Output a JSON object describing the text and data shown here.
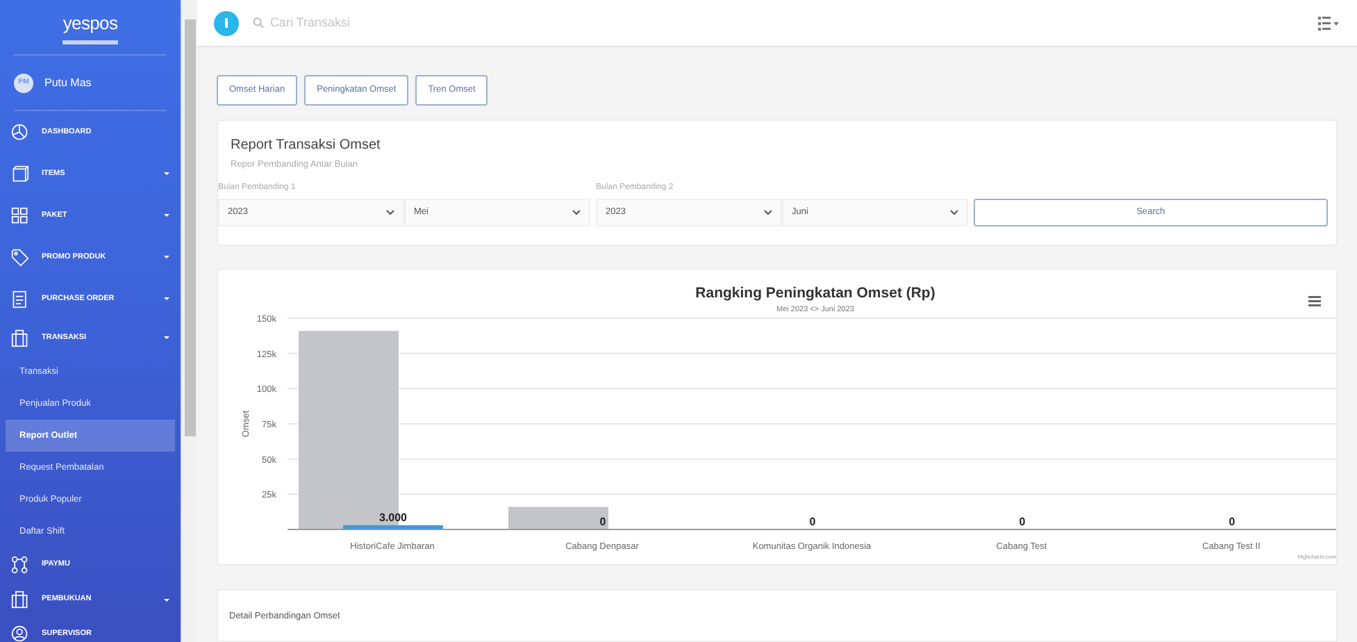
{
  "sidebar": {
    "logo": "yespos",
    "user": {
      "initials": "PM",
      "name": "Putu Mas"
    },
    "items": [
      {
        "label": "DASHBOARD",
        "has_caret": false
      },
      {
        "label": "ITEMS",
        "has_caret": true
      },
      {
        "label": "PAKET",
        "has_caret": true
      },
      {
        "label": "PROMO PRODUK",
        "has_caret": true
      },
      {
        "label": "PURCHASE ORDER",
        "has_caret": true
      },
      {
        "label": "TRANSAKSI",
        "has_caret": true,
        "children": [
          {
            "label": "Transaksi",
            "selected": false
          },
          {
            "label": "Penjualan Produk",
            "selected": false
          },
          {
            "label": "Report Outlet",
            "selected": true
          },
          {
            "label": "Request Pembatalan",
            "selected": false
          },
          {
            "label": "Produk Populer",
            "selected": false
          },
          {
            "label": "Daftar Shift",
            "selected": false
          }
        ]
      },
      {
        "label": "IPAYMU",
        "has_caret": false
      },
      {
        "label": "PEMBUKUAN",
        "has_caret": true
      },
      {
        "label": "SUPERVISOR",
        "has_caret": false
      }
    ]
  },
  "topbar": {
    "search": {
      "placeholder": "Cari Transaksi"
    }
  },
  "report_tabs": [
    "Omset Harian",
    "Peningkatan Omset",
    "Tren Omset"
  ],
  "form": {
    "title": "Report Transaksi Omset",
    "subtitle": "Repor Pembanding Antar Bulan",
    "groups": [
      {
        "label": "Bulan Pembanding 1",
        "year": "2023",
        "month": "Mei"
      },
      {
        "label": "Bulan Pembanding 2",
        "year": "2023",
        "month": "Juni"
      }
    ],
    "search_button": "Search"
  },
  "chart": {
    "credit": "Highcharts.com",
    "chart_data": {
      "type": "bar",
      "orientation": "vertical",
      "title": "Rangking Peningkatan Omset (Rp)",
      "subtitle": "Mei 2023 <> Juni 2023",
      "ylabel": "Omset",
      "categories": [
        "HistoriCafe Jimbaran",
        "Cabang Denpasar",
        "Komunitas Organik Indonesia",
        "Cabang Test",
        "Cabang Test II"
      ],
      "series": [
        {
          "color": "#c4c5c9",
          "values": [
            141000,
            16000,
            0,
            0,
            0
          ]
        },
        {
          "color": "#3a9be0",
          "values": [
            3000,
            0,
            0,
            0,
            0
          ]
        }
      ],
      "ylim": [
        0,
        150000
      ],
      "grid": true,
      "yticks": [
        {
          "value": 25000,
          "label": "25k"
        },
        {
          "value": 50000,
          "label": "50k"
        },
        {
          "value": 75000,
          "label": "75k"
        },
        {
          "value": 100000,
          "label": "100k"
        },
        {
          "value": 125000,
          "label": "125k"
        },
        {
          "value": 150000,
          "label": "150k"
        }
      ],
      "value_labels": [
        "3.000",
        "0",
        "0",
        "0",
        "0"
      ]
    }
  },
  "detail_card": {
    "title": "Detail Perbandingan Omset"
  }
}
